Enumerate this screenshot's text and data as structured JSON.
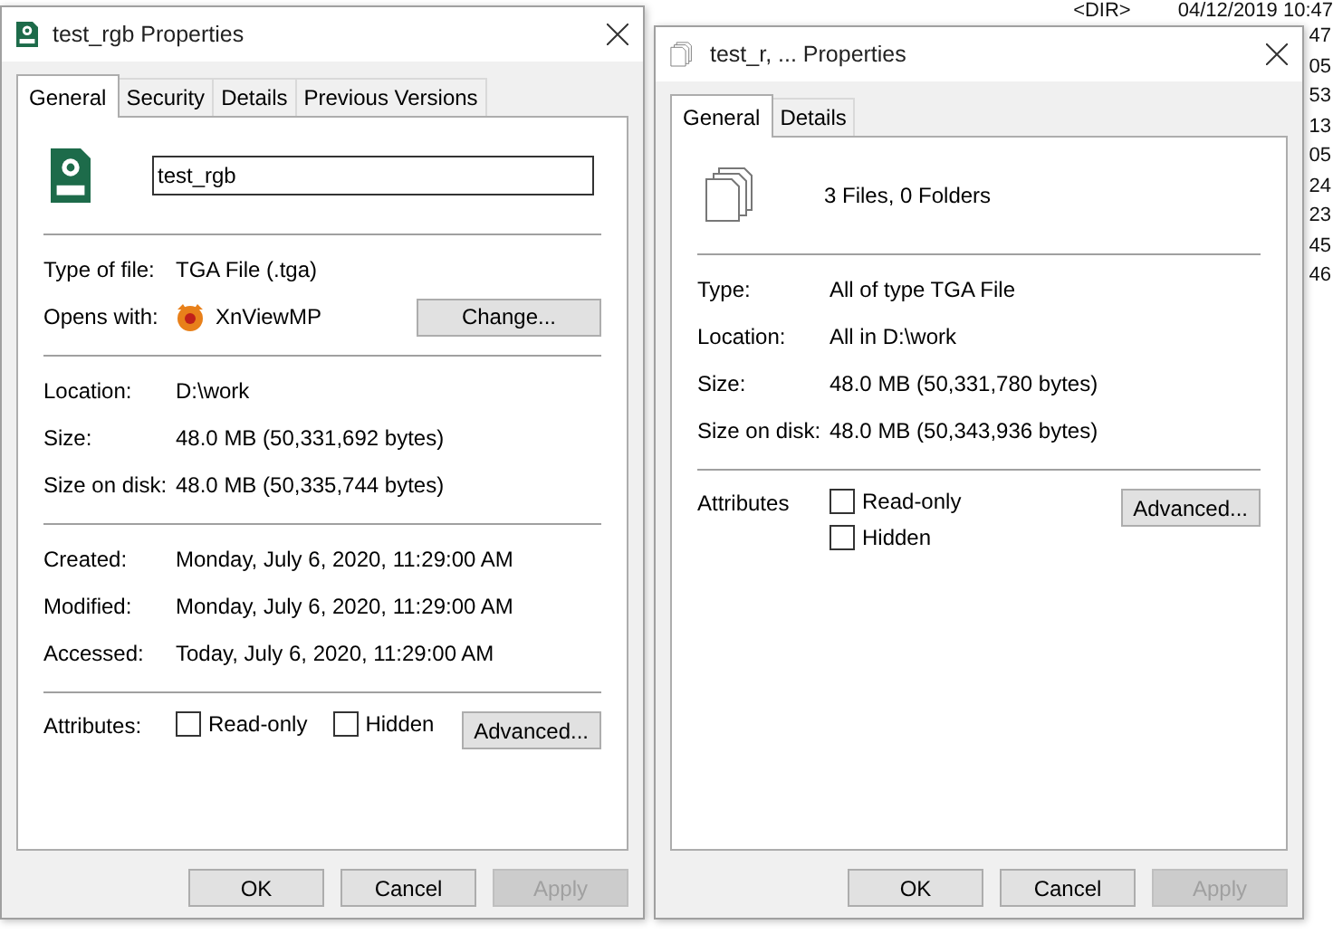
{
  "background_listing": {
    "header": [
      "<DIR>",
      "04/12/2019 10:47"
    ],
    "times": [
      "47",
      "05",
      "53",
      "13",
      "05",
      "24",
      "23",
      "45",
      "46"
    ]
  },
  "windows": [
    {
      "title": "test_rgb Properties",
      "tabs": [
        {
          "label": "General",
          "selected": true
        },
        {
          "label": "Security",
          "selected": false
        },
        {
          "label": "Details",
          "selected": false
        },
        {
          "label": "Previous Versions",
          "selected": false
        }
      ],
      "header": {
        "kind": "name_field",
        "value": "test_rgb"
      },
      "sections": [
        [
          {
            "kind": "field",
            "label": "Type of file:",
            "value": "TGA File (.tga)"
          },
          {
            "kind": "opens",
            "label": "Opens with:",
            "value": "XnViewMP",
            "button": "Change..."
          }
        ],
        [
          {
            "kind": "field",
            "label": "Location:",
            "value": "D:\\work"
          },
          {
            "kind": "field",
            "label": "Size:",
            "value": "48.0 MB (50,331,692 bytes)"
          },
          {
            "kind": "field",
            "label": "Size on disk:",
            "value": "48.0 MB (50,335,744 bytes)"
          }
        ],
        [
          {
            "kind": "field",
            "label": "Created:",
            "value": "Monday, July 6, 2020, 11:29:00 AM"
          },
          {
            "kind": "field",
            "label": "Modified:",
            "value": "Monday, July 6, 2020, 11:29:00 AM"
          },
          {
            "kind": "field",
            "label": "Accessed:",
            "value": "Today, July 6, 2020, 11:29:00 AM"
          }
        ],
        [
          {
            "kind": "attributes",
            "label": "Attributes:",
            "checkboxes": [
              {
                "label": "Read-only",
                "checked": false
              },
              {
                "label": "Hidden",
                "checked": false
              }
            ],
            "button": "Advanced..."
          }
        ]
      ],
      "buttons": [
        {
          "label": "OK",
          "disabled": false
        },
        {
          "label": "Cancel",
          "disabled": false
        },
        {
          "label": "Apply",
          "disabled": true
        }
      ]
    },
    {
      "title": "test_r, ... Properties",
      "tabs": [
        {
          "label": "General",
          "selected": true
        },
        {
          "label": "Details",
          "selected": false
        }
      ],
      "header": {
        "kind": "summary",
        "value": "3 Files, 0 Folders"
      },
      "sections": [
        [
          {
            "kind": "field",
            "label": "Type:",
            "value": "All of type TGA File"
          },
          {
            "kind": "field",
            "label": "Location:",
            "value": "All in D:\\work"
          },
          {
            "kind": "field",
            "label": "Size:",
            "value": "48.0 MB (50,331,780 bytes)"
          },
          {
            "kind": "field",
            "label": "Size on disk:",
            "value": "48.0 MB (50,343,936 bytes)"
          }
        ],
        [
          {
            "kind": "attributes_stacked",
            "label": "Attributes",
            "checkboxes": [
              {
                "label": "Read-only",
                "checked": false
              },
              {
                "label": "Hidden",
                "checked": false
              }
            ],
            "button": "Advanced..."
          }
        ]
      ],
      "buttons": [
        {
          "label": "OK",
          "disabled": false
        },
        {
          "label": "Cancel",
          "disabled": false
        },
        {
          "label": "Apply",
          "disabled": true
        }
      ]
    }
  ]
}
